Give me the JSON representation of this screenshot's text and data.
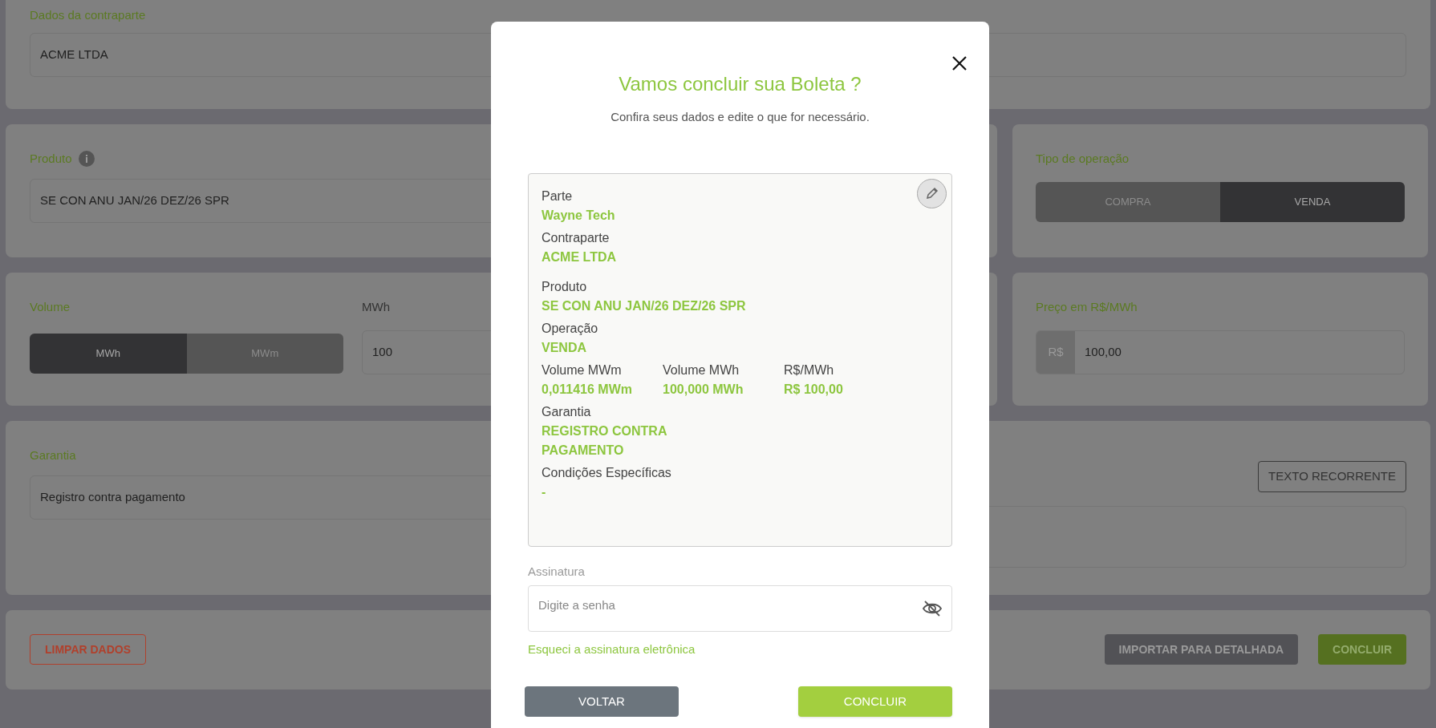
{
  "form": {
    "counterparty": {
      "label": "Dados da contraparte",
      "value": "ACME LTDA"
    },
    "product": {
      "label": "Produto",
      "value": "SE CON ANU JAN/26 DEZ/26 SPR"
    },
    "operation_type": {
      "label": "Tipo de operação",
      "options": [
        {
          "label": "COMPRA",
          "selected": false
        },
        {
          "label": "VENDA",
          "selected": true
        }
      ]
    },
    "volume": {
      "label": "Volume",
      "options": [
        {
          "label": "MWh",
          "selected": true
        },
        {
          "label": "MWm",
          "selected": false
        }
      ],
      "field_label": "MWh",
      "value": "100"
    },
    "price": {
      "label": "Preço em R$/MWh",
      "prefix": "R$",
      "value": "100,00"
    },
    "guarantee": {
      "label": "Garantia",
      "value": "Registro contra pagamento",
      "recurring_button": "TEXTO RECORRENTE"
    },
    "actions": {
      "clear": "LIMPAR DADOS",
      "import": "IMPORTAR PARA DETALHADA",
      "conclude": "CONCLUIR"
    }
  },
  "modal": {
    "title": "Vamos concluir sua Boleta ?",
    "subtitle": "Confira seus dados e edite o que for necessário.",
    "summary": [
      [
        {
          "label": "Parte",
          "value": "Wayne Tech"
        }
      ],
      [
        {
          "label": "Contraparte",
          "value": "ACME LTDA"
        }
      ],
      [
        {
          "label": "Produto",
          "value": "SE CON ANU JAN/26 DEZ/26 SPR"
        }
      ],
      [
        {
          "label": "Operação",
          "value": "VENDA"
        }
      ],
      [
        {
          "label": "Volume MWm",
          "value": "0,011416 MWm"
        },
        {
          "label": "Volume MWh",
          "value": "100,000 MWh"
        },
        {
          "label": "R$/MWh",
          "value": "R$ 100,00"
        }
      ],
      [
        {
          "label": "Garantia",
          "value": "REGISTRO CONTRA PAGAMENTO"
        }
      ],
      [
        {
          "label": "Condições Específicas",
          "value": "-"
        }
      ]
    ],
    "signature": {
      "label": "Assinatura",
      "placeholder": "Digite a senha"
    },
    "forgot_link": "Esqueci a assinatura eletrônica",
    "buttons": {
      "back": "VOLTAR",
      "conclude": "CONCLUIR"
    }
  }
}
